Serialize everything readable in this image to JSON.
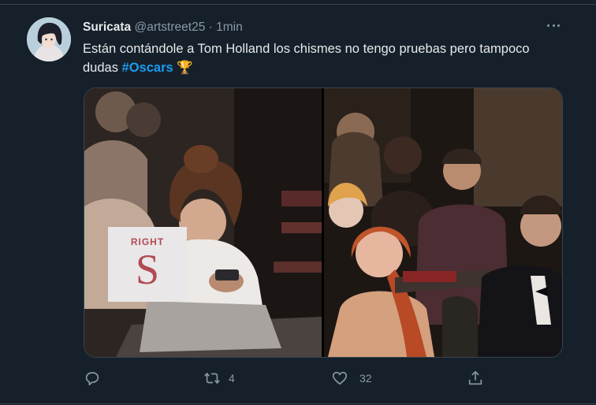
{
  "tweet": {
    "display_name": "Suricata",
    "handle": "@artstreet25",
    "separator": "·",
    "time": "1min",
    "text_before": "Están contándole a Tom Holland los chismes no tengo pruebas pero tampoco dudas ",
    "hashtag": "#Oscars",
    "trophy": "🏆",
    "left_photo": {
      "sign_top": "RIGHT",
      "sign_letter": "S"
    }
  },
  "actions": {
    "reply_count": "",
    "retweet_count": "4",
    "like_count": "32"
  },
  "icons": {
    "more": "more-icon",
    "reply": "reply-icon",
    "retweet": "retweet-icon",
    "like": "heart-icon",
    "share": "share-icon"
  },
  "colors": {
    "background": "#15202b",
    "text": "#e7e9ea",
    "muted": "#8b98a5",
    "accent": "#1d9bf0",
    "border": "#38444d"
  }
}
